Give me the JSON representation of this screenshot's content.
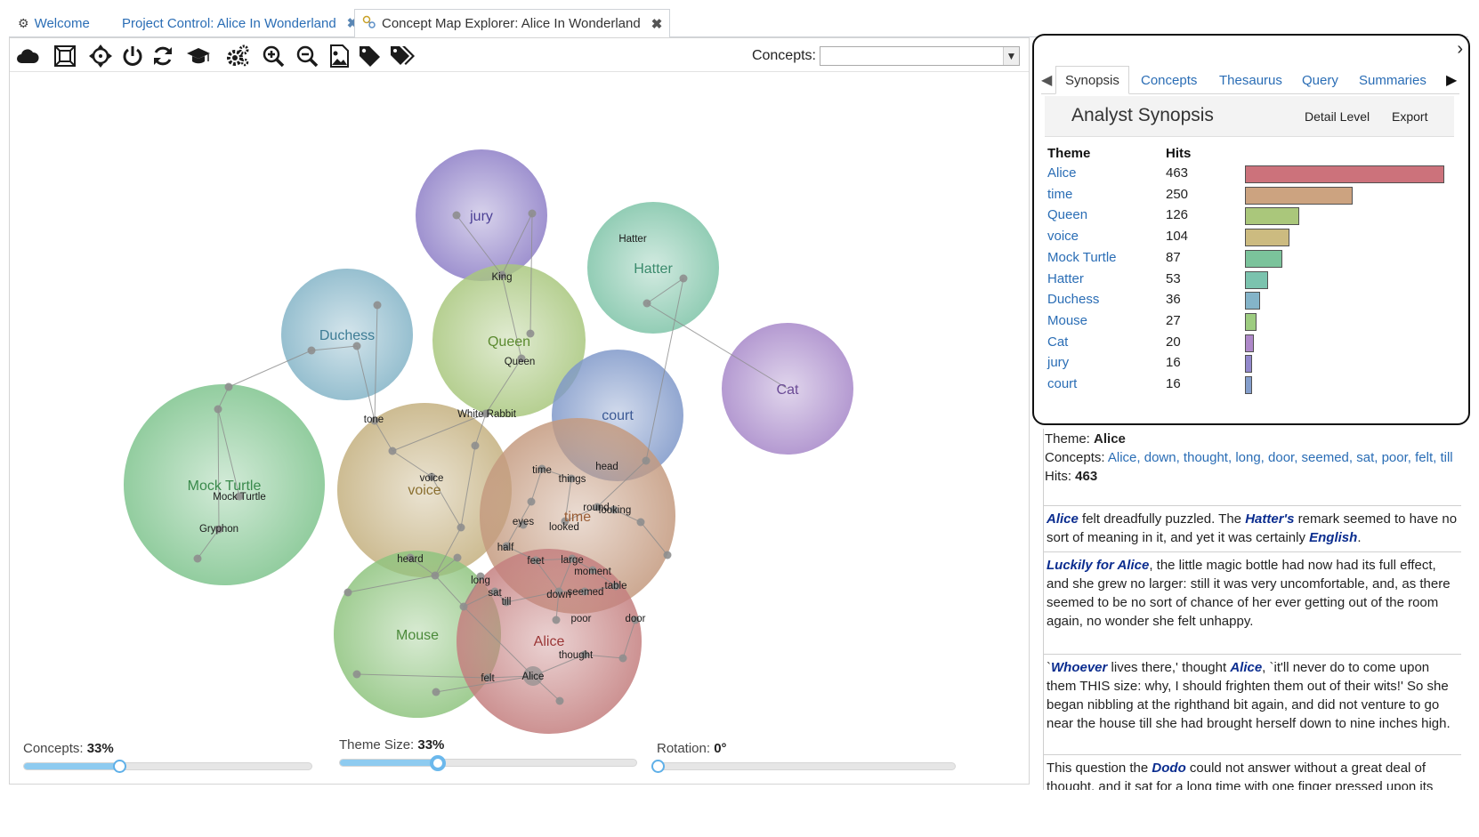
{
  "tabs": [
    {
      "label": "Welcome",
      "icon": "gear-icon",
      "closable": false,
      "active": false
    },
    {
      "label": "Project Control: Alice In Wonderland",
      "closable": true,
      "active": false
    },
    {
      "label": "Concept Map Explorer: Alice In Wonderland",
      "icon": "concept-map-icon",
      "closable": true,
      "active": true
    }
  ],
  "toolbar": {
    "tools": [
      "cloud-icon",
      "fit-frame-icon",
      "move-icon",
      "power-icon",
      "refresh-icon",
      "graduation-cap-icon",
      "settings-icon",
      "zoom-in-icon",
      "zoom-out-icon",
      "image-icon",
      "tag-icon",
      "tags-icon"
    ],
    "concepts_label": "Concepts:",
    "concepts_value": ""
  },
  "map": {
    "themes": [
      {
        "name": "jury",
        "color": "#8e7fc7",
        "text_color": "#4b3f95"
      },
      {
        "name": "Hatter",
        "color": "#7fc4a8",
        "text_color": "#3a8a6c"
      },
      {
        "name": "Duchess",
        "color": "#84b4c7",
        "text_color": "#3e7c95"
      },
      {
        "name": "Queen",
        "color": "#a9c77e",
        "text_color": "#5b8a2f"
      },
      {
        "name": "Cat",
        "color": "#a788c9",
        "text_color": "#6a4a95"
      },
      {
        "name": "court",
        "color": "#7f98c9",
        "text_color": "#3c5a95"
      },
      {
        "name": "Mock Turtle",
        "color": "#7fc48e",
        "text_color": "#3a8a4c"
      },
      {
        "name": "voice",
        "color": "#c4b07f",
        "text_color": "#8a6f2f"
      },
      {
        "name": "time",
        "color": "#c49a7f",
        "text_color": "#9a5d35"
      },
      {
        "name": "Mouse",
        "color": "#8fc47f",
        "text_color": "#4b8a3a"
      },
      {
        "name": "Alice",
        "color": "#c47f7f",
        "text_color": "#9a3535"
      }
    ],
    "concepts": [
      "King",
      "Hatter",
      "Queen",
      "White Rabbit",
      "tone",
      "head",
      "time",
      "things",
      "round",
      "looking",
      "eyes",
      "looked",
      "voice",
      "Mock Turtle",
      "Gryphon",
      "half",
      "heard",
      "feet",
      "large",
      "moment",
      "table",
      "long",
      "sat",
      "till",
      "down",
      "seemed",
      "poor",
      "door",
      "thought",
      "felt",
      "Alice"
    ]
  },
  "sliders": [
    {
      "label": "Concepts:",
      "value": "33%",
      "fraction": 0.33
    },
    {
      "label": "Theme Size:",
      "value": "33%",
      "fraction": 0.33
    },
    {
      "label": "Rotation:",
      "value": "0°",
      "fraction": 0.0
    }
  ],
  "panel": {
    "subtabs": [
      "Synopsis",
      "Concepts",
      "Thesaurus",
      "Query",
      "Summaries"
    ],
    "title": "Analyst Synopsis",
    "detail_level": "Detail Level",
    "export": "Export",
    "table_headers": {
      "theme": "Theme",
      "hits": "Hits"
    },
    "themes": [
      {
        "name": "Alice",
        "hits": 463,
        "color": "#c45a64"
      },
      {
        "name": "time",
        "hits": 250,
        "color": "#c4936a"
      },
      {
        "name": "Queen",
        "hits": 126,
        "color": "#9cbe64"
      },
      {
        "name": "voice",
        "hits": 104,
        "color": "#c4b06a"
      },
      {
        "name": "Mock Turtle",
        "hits": 87,
        "color": "#64b98a"
      },
      {
        "name": "Hatter",
        "hits": 53,
        "color": "#64b9a0"
      },
      {
        "name": "Duchess",
        "hits": 36,
        "color": "#6fa8c0"
      },
      {
        "name": "Mouse",
        "hits": 27,
        "color": "#8cc46a"
      },
      {
        "name": "Cat",
        "hits": 20,
        "color": "#a074c0"
      },
      {
        "name": "jury",
        "hits": 16,
        "color": "#8074c4"
      },
      {
        "name": "court",
        "hits": 16,
        "color": "#6f8ec4"
      }
    ]
  },
  "theme_detail": {
    "theme_label": "Theme:",
    "theme": "Alice",
    "concepts_label": "Concepts:",
    "concepts": "Alice, down, thought, long, door, seemed, sat, poor, felt, till",
    "hits_label": "Hits:",
    "hits": "463"
  },
  "excerpts": [
    {
      "parts": [
        [
          "em",
          "Alice"
        ],
        [
          "t",
          " felt dreadfully puzzled. The "
        ],
        [
          "em",
          "Hatter's"
        ],
        [
          "t",
          " remark seemed to have no sort of meaning in it, and yet it was certainly "
        ],
        [
          "em",
          "English"
        ],
        [
          "t",
          "."
        ]
      ]
    },
    {
      "parts": [
        [
          "em",
          "Luckily for Alice"
        ],
        [
          "t",
          ", the little magic bottle had now had its full effect, and she grew no larger: still it was very uncomfortable, and, as there seemed to be no sort of chance of her ever getting out of the room again, no wonder she felt unhappy."
        ]
      ]
    },
    {
      "parts": [
        [
          "t",
          "`"
        ],
        [
          "em",
          "Whoever"
        ],
        [
          "t",
          " lives there,' thought "
        ],
        [
          "em",
          "Alice"
        ],
        [
          "t",
          ", `it'll never do to come upon them THIS size: why, I should frighten them out of their wits!' So she began nibbling at the righthand bit again, and did not venture to go near the house till she had brought herself down to nine inches high."
        ]
      ]
    },
    {
      "parts": [
        [
          "t",
          "This question the "
        ],
        [
          "em",
          "Dodo"
        ],
        [
          "t",
          " could not answer without a great deal of thought, and it sat for a long time with one finger pressed upon its forehead."
        ]
      ]
    }
  ]
}
